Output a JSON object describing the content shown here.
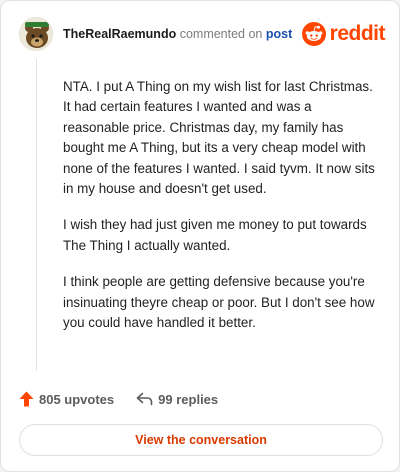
{
  "header": {
    "username": "TheRealRaemundo",
    "action_text": "commented on",
    "post_link": "post",
    "brand_wordmark": "reddit"
  },
  "comment": {
    "paragraphs": [
      "NTA. I put A Thing on my wish list for last Christmas. It had certain features I wanted and was a reasonable price. Christmas day, my family has bought me A Thing, but its a very cheap model with none of the features I wanted. I said tyvm. It now sits in my house and doesn't get used.",
      "I wish they had just given me money to put towards The Thing I actually wanted.",
      "I think people are getting defensive because you're insinuating theyre cheap or poor. But I don't see how you could have handled it better."
    ]
  },
  "stats": {
    "upvotes": "805 upvotes",
    "replies": "99 replies"
  },
  "cta": {
    "label": "View the conversation"
  },
  "icons": {
    "avatar": "user-avatar-icon",
    "brand": "reddit-logo-icon",
    "upvote": "upvote-arrow-icon",
    "reply": "reply-arrow-icon"
  },
  "colors": {
    "brand_orange": "#ff4500",
    "upvote_orange": "#ff4500",
    "link_blue": "#1a4fae",
    "cta_text": "#d93a00",
    "muted_text": "#7c7c7c"
  }
}
